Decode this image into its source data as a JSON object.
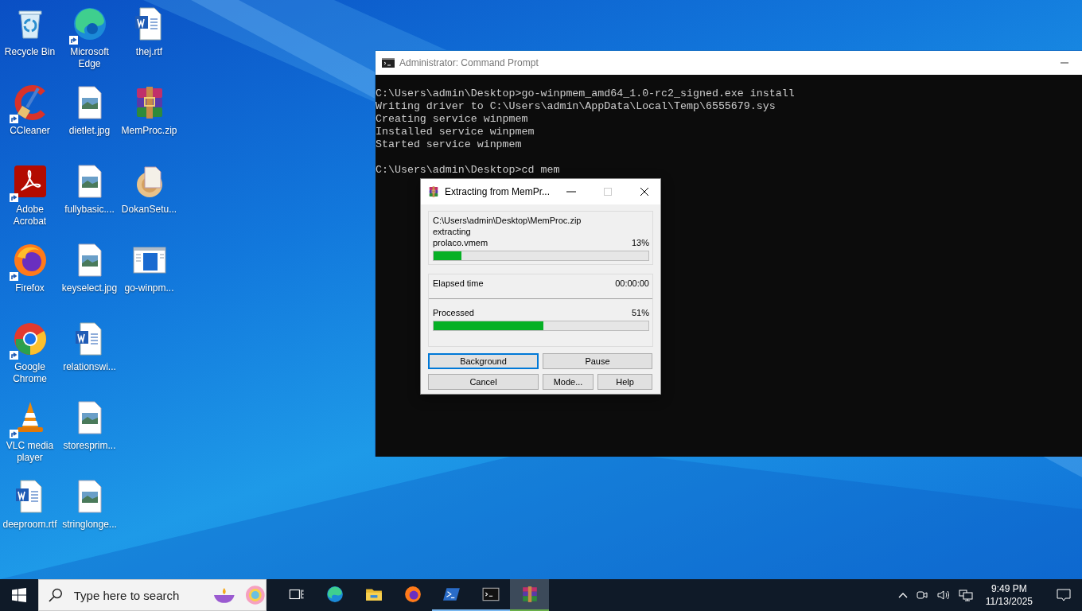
{
  "desktop": {
    "columns": [
      [
        {
          "label": "Recycle Bin",
          "kind": "recycle",
          "shortcut": false
        },
        {
          "label": "CCleaner",
          "kind": "ccleaner",
          "shortcut": true
        },
        {
          "label": "Adobe Acrobat",
          "kind": "acrobat",
          "shortcut": true
        },
        {
          "label": "Firefox",
          "kind": "firefox",
          "shortcut": true
        },
        {
          "label": "Google Chrome",
          "kind": "chrome",
          "shortcut": true
        },
        {
          "label": "VLC media player",
          "kind": "vlc",
          "shortcut": true
        },
        {
          "label": "deeproom.rtf",
          "kind": "word",
          "shortcut": false
        }
      ],
      [
        {
          "label": "Microsoft Edge",
          "kind": "edge",
          "shortcut": true
        },
        {
          "label": "dietlet.jpg",
          "kind": "image",
          "shortcut": false
        },
        {
          "label": "fullybasic....",
          "kind": "image",
          "shortcut": false
        },
        {
          "label": "keyselect.jpg",
          "kind": "image",
          "shortcut": false
        },
        {
          "label": "relationswi...",
          "kind": "word",
          "shortcut": false
        },
        {
          "label": "storesprim...",
          "kind": "image",
          "shortcut": false
        },
        {
          "label": "stringlonge...",
          "kind": "image",
          "shortcut": false
        }
      ],
      [
        {
          "label": "thej.rtf",
          "kind": "word",
          "shortcut": false
        },
        {
          "label": "MemProc.zip",
          "kind": "winrar",
          "shortcut": false
        },
        {
          "label": "DokanSetu...",
          "kind": "dokan",
          "shortcut": false
        },
        {
          "label": "go-winpm...",
          "kind": "exe",
          "shortcut": false
        }
      ]
    ]
  },
  "console_window": {
    "title": "Administrator: Command Prompt",
    "paragraphs": [
      [
        "C:\\Users\\admin\\Desktop>go-winpmem_amd64_1.0-rc2_signed.exe install",
        "Writing driver to C:\\Users\\admin\\AppData\\Local\\Temp\\6555679.sys",
        "Creating service winpmem",
        "Installed service winpmem",
        "Started service winpmem"
      ],
      [
        "C:\\Users\\admin\\Desktop>cd mem"
      ]
    ]
  },
  "extract_dialog": {
    "title": "Extracting from MemPr...",
    "archive_path": "C:\\Users\\admin\\Desktop\\MemProc.zip",
    "action": "extracting",
    "file_name": "prolaco.vmem",
    "file_percent": "13%",
    "file_progress": {
      "level": 0.13
    },
    "elapsed_label": "Elapsed time",
    "elapsed_value": "00:00:00",
    "processed_label": "Processed",
    "processed_percent": "51%",
    "processed_progress": {
      "level": 0.51
    },
    "buttons": [
      {
        "label": "Background",
        "focused": true
      },
      {
        "label": "Pause",
        "focused": false
      },
      {
        "label": "Cancel",
        "focused": false
      },
      {
        "label": "Mode...",
        "focused": false
      },
      {
        "label": "Help",
        "focused": false
      }
    ]
  },
  "taskbar": {
    "search": {
      "placeholder": "Type here to search"
    },
    "apps": [
      {
        "kind": "taskview",
        "running": false,
        "selected": false
      },
      {
        "kind": "edge",
        "running": false,
        "selected": false
      },
      {
        "kind": "folder",
        "running": false,
        "selected": false
      },
      {
        "kind": "firefox",
        "running": false,
        "selected": false
      },
      {
        "kind": "powershell",
        "running": true,
        "selected": false
      },
      {
        "kind": "cmd",
        "running": true,
        "selected": false
      },
      {
        "kind": "winrar",
        "running": true,
        "selected": true
      }
    ],
    "clock": {
      "time": "9:49 PM",
      "date": "11/13/2025"
    }
  }
}
